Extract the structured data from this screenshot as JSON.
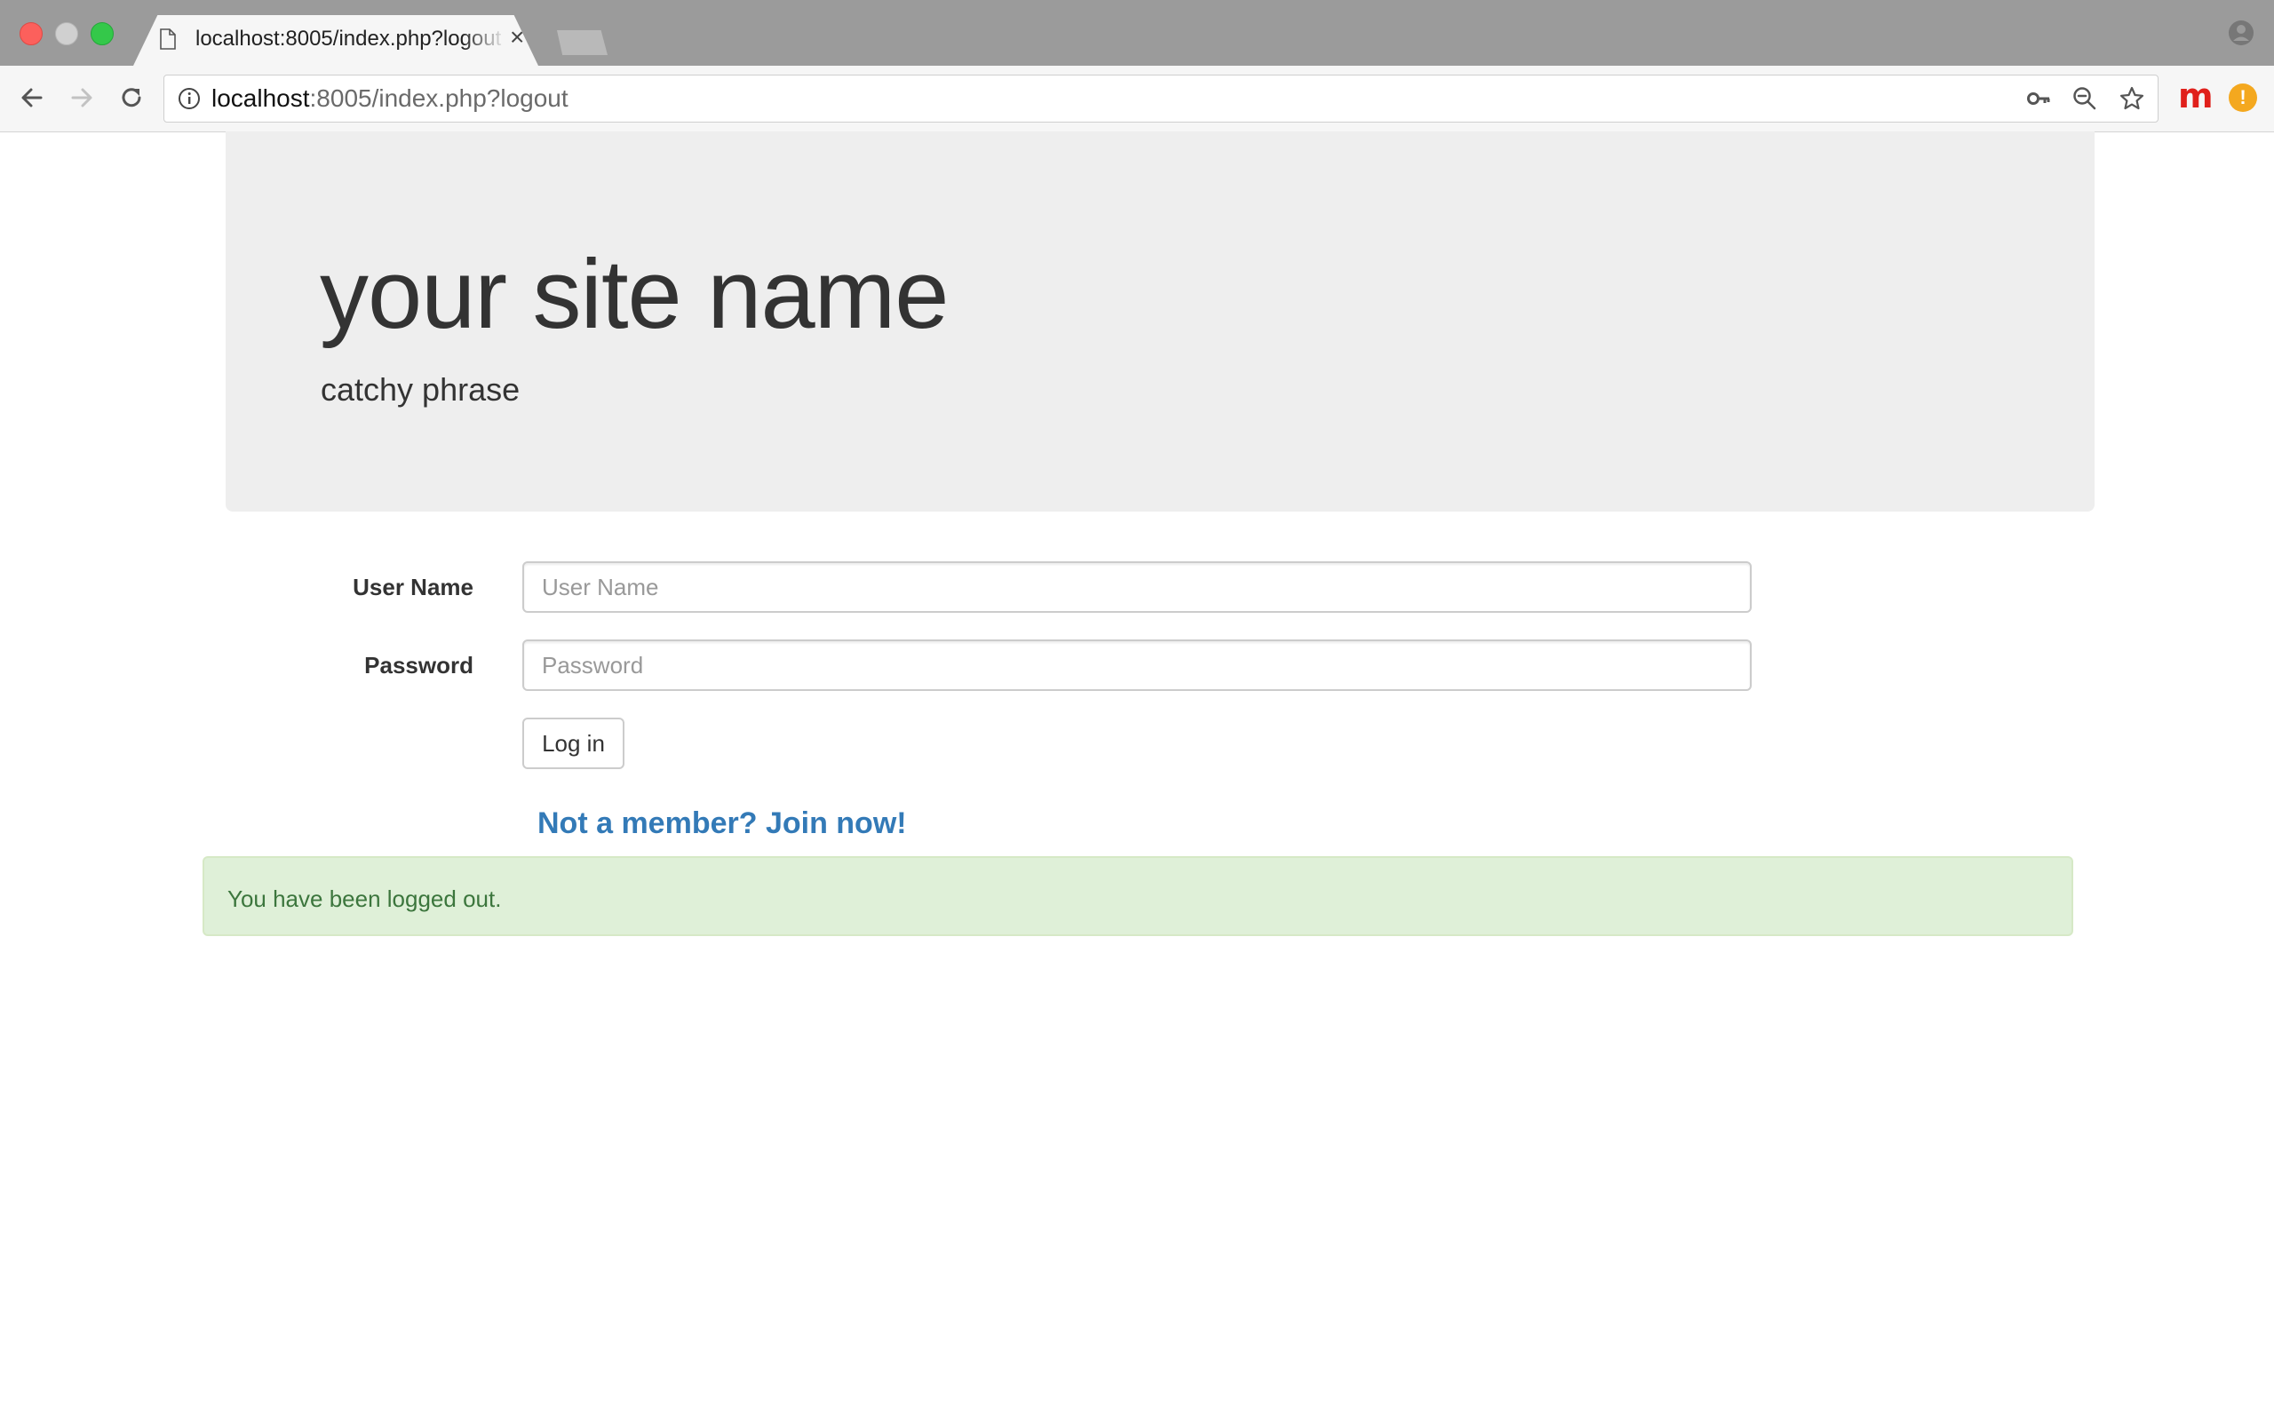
{
  "browser": {
    "tab": {
      "title": "localhost:8005/index.php?logout",
      "close": "×"
    },
    "address": {
      "host": "localhost",
      "rest": ":8005/index.php?logout"
    },
    "extensions": {
      "m_label": "m",
      "warn_label": "!"
    }
  },
  "site": {
    "name": "your site name",
    "tagline": "catchy phrase"
  },
  "login_form": {
    "username_label": "User Name",
    "username_placeholder": "User Name",
    "username_value": "",
    "password_label": "Password",
    "password_placeholder": "Password",
    "password_value": "",
    "submit_label": "Log in",
    "join_link": "Not a member? Join now!"
  },
  "alert": {
    "message": "You have been logged out.",
    "type": "success"
  },
  "colors": {
    "link": "#337ab7",
    "alert_bg": "#dff0d8",
    "alert_text": "#3c763d",
    "jumbotron_bg": "#eeeeee"
  },
  "icons": [
    "file-icon",
    "close-icon",
    "profile-icon",
    "back-arrow-icon",
    "forward-arrow-icon",
    "reload-icon",
    "info-icon",
    "key-icon",
    "zoom-out-icon",
    "star-icon"
  ]
}
